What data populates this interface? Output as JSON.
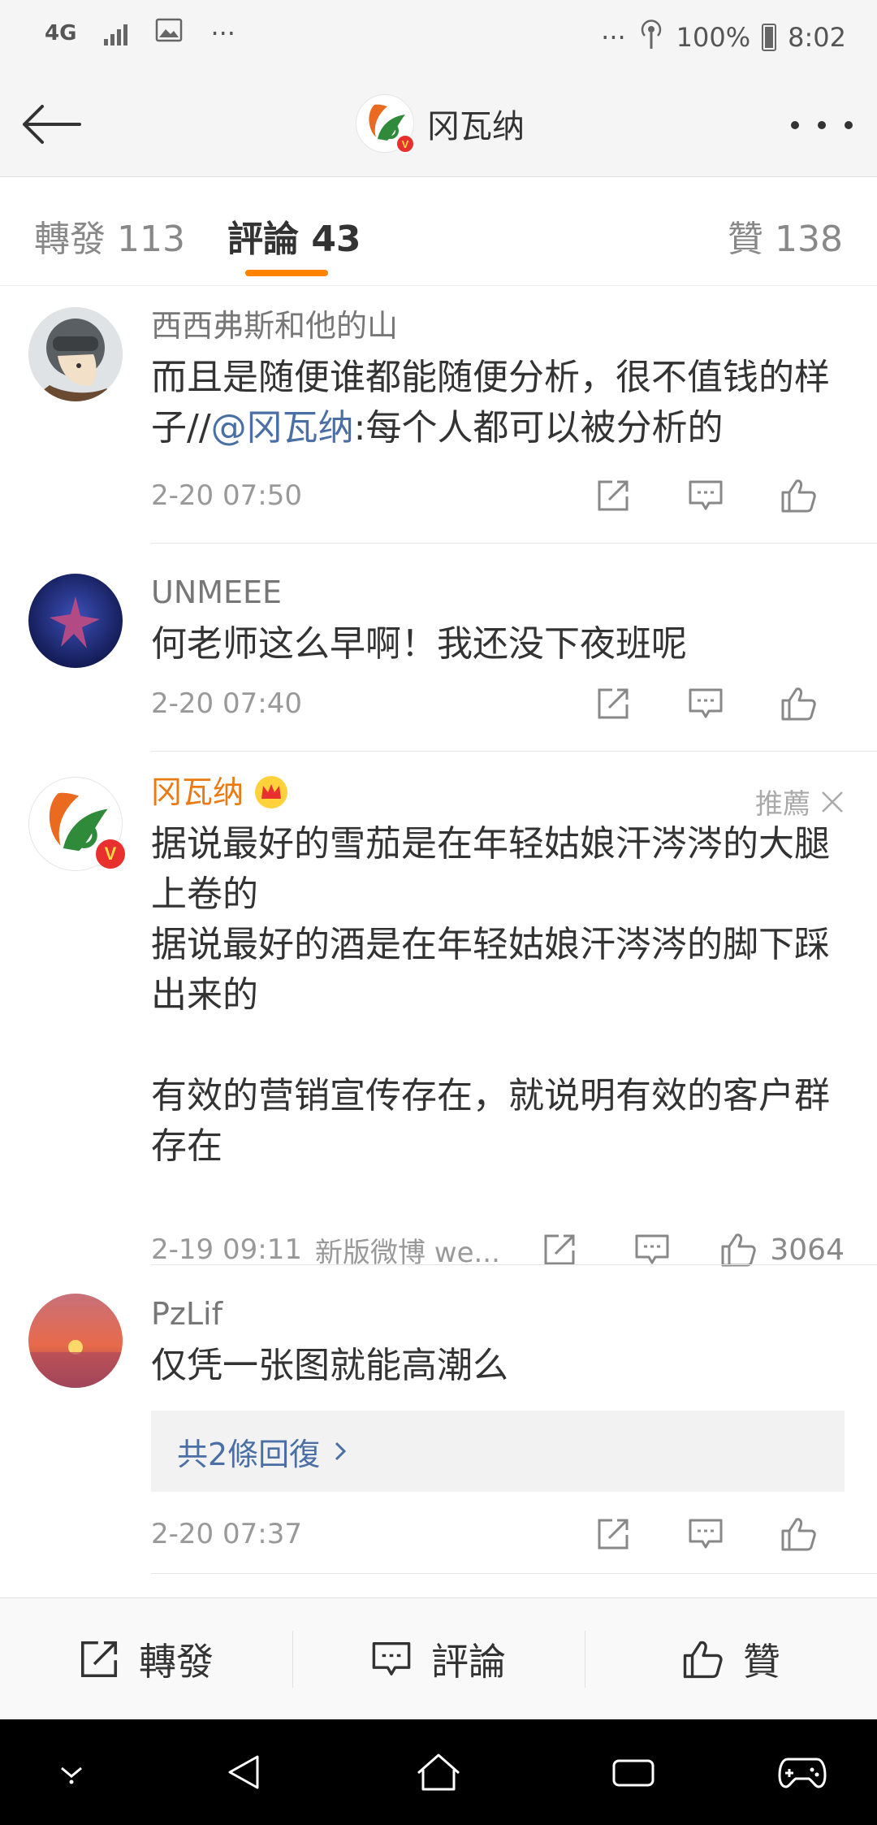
{
  "status_bar": {
    "network": "4G",
    "more": "···",
    "right_more": "···",
    "battery": "100%",
    "time": "8:02"
  },
  "nav": {
    "title": "冈瓦纳",
    "verified_badge": "V"
  },
  "tabs": {
    "reposts": "轉發 113",
    "comments": "評論 43",
    "likes": "贊 138"
  },
  "comments": [
    {
      "username": "西西弗斯和他的山",
      "text_before": "而且是随便谁都能随便分析，很不值钱的样子//",
      "mention": "@冈瓦纳",
      "text_after": ":每个人都可以被分析的",
      "time": "2-20 07:50"
    },
    {
      "username": "UNMEEE",
      "text": "何老师这么早啊！我还没下夜班呢",
      "time": "2-20 07:40"
    },
    {
      "username": "冈瓦纳",
      "recommend": "推薦",
      "verified_badge": "V",
      "text": "据说最好的雪茄是在年轻姑娘汗涔涔的大腿上卷的\n据说最好的酒是在年轻姑娘汗涔涔的脚下踩出来的\n\n有效的营销宣传存在，就说明有效的客户群存在",
      "time": "2-19 09:11",
      "source": "新版微博 we...",
      "like_count": "3064"
    },
    {
      "username": "PzLif",
      "text": "仅凭一张图就能高潮么",
      "replies": "共2條回復",
      "time": "2-20 07:37"
    }
  ],
  "bottom_bar": {
    "repost": "轉發",
    "comment": "評論",
    "like": "贊"
  },
  "colors": {
    "accent": "#ff8200",
    "mention": "#4a6fa5",
    "vip_name": "#ea7b14",
    "verified": "#e8312f"
  }
}
